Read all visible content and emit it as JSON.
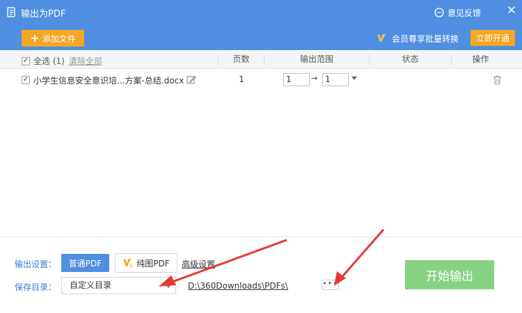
{
  "window": {
    "title": "输出为PDF",
    "feedback_label": "意见反馈",
    "close_label": "✕"
  },
  "toolbar": {
    "add_file_label": "添加文件",
    "vip_promo_text": "会员尊享批量转换",
    "open_vip_label": "立即开通"
  },
  "table": {
    "select_all_label": "全选 (1)",
    "clear_all_label": "清除全部",
    "columns": {
      "pages": "页数",
      "range": "输出范围",
      "status": "状态",
      "actions": "操作"
    },
    "rows": [
      {
        "checked": true,
        "filename": "小学生信息安全意识培...方案-总结.docx",
        "pages": "1",
        "range_from": "1",
        "range_to": "1",
        "status": ""
      }
    ]
  },
  "settings": {
    "output_label": "输出设置：",
    "normal_pdf_label": "普通PDF",
    "image_pdf_label": "纯图PDF",
    "advanced_label": "高级设置",
    "save_dir_label": "保存目录：",
    "dir_select_value": "自定义目录",
    "path_value": "D:\\360Downloads\\PDFs\\",
    "more_label": "•••",
    "start_label": "开始输出"
  },
  "colors": {
    "header_blue": "#4f8fe1",
    "orange": "#f5a623",
    "start_green": "#86d282",
    "annotation_red": "#e53935"
  },
  "icons": [
    "app-icon",
    "feedback-icon",
    "close-icon",
    "plus-icon",
    "vip-icon",
    "checkbox-icon",
    "edit-icon",
    "trash-icon",
    "dropdown-icon"
  ]
}
